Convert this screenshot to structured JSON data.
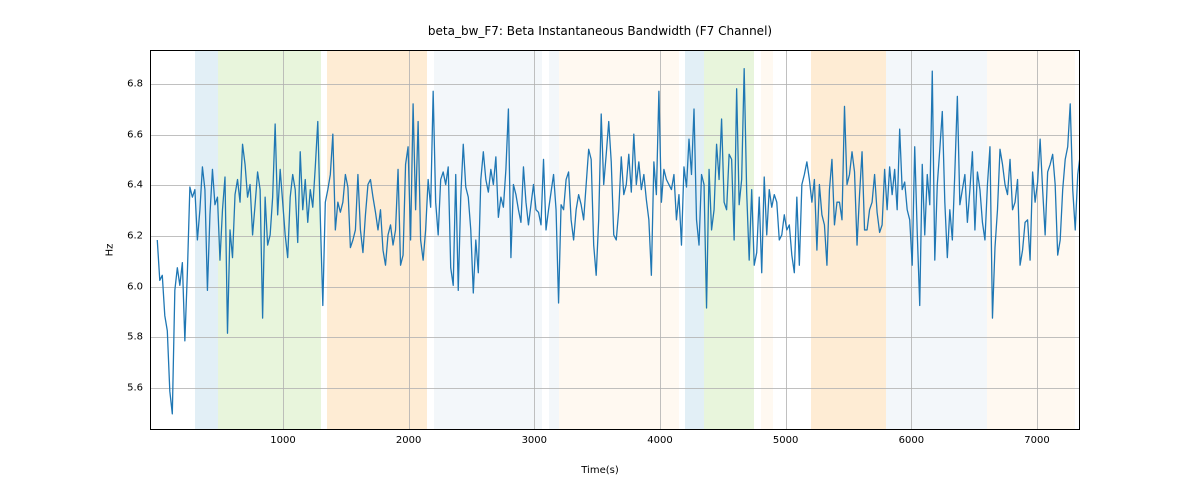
{
  "chart_data": {
    "type": "line",
    "title": "beta_bw_F7: Beta Instantaneous Bandwidth (F7 Channel)",
    "xlabel": "Time(s)",
    "ylabel": "Hz",
    "xlim": [
      -50,
      7350
    ],
    "ylim": [
      5.43,
      6.93
    ],
    "xticks": [
      "1000",
      "2000",
      "3000",
      "4000",
      "5000",
      "6000",
      "7000"
    ],
    "yticks": [
      "5.6",
      "5.8",
      "6.0",
      "6.2",
      "6.4",
      "6.6",
      "6.8"
    ],
    "spans": [
      {
        "x0": 300,
        "x1": 480,
        "color": "#9ec9e2"
      },
      {
        "x0": 480,
        "x1": 1300,
        "color": "#b2df8a"
      },
      {
        "x0": 1350,
        "x1": 2150,
        "color": "#fdbf6f"
      },
      {
        "x0": 2200,
        "x1": 3060,
        "color": "#d6e4f0"
      },
      {
        "x0": 3120,
        "x1": 3200,
        "color": "#d6e4f0"
      },
      {
        "x0": 3200,
        "x1": 4150,
        "color": "#ffecd1"
      },
      {
        "x0": 4200,
        "x1": 4350,
        "color": "#9ec9e2"
      },
      {
        "x0": 4350,
        "x1": 4750,
        "color": "#b2df8a"
      },
      {
        "x0": 4800,
        "x1": 4900,
        "color": "#ffecd1"
      },
      {
        "x0": 5200,
        "x1": 5800,
        "color": "#fdbf6f"
      },
      {
        "x0": 5800,
        "x1": 6600,
        "color": "#d6e4f0"
      },
      {
        "x0": 6600,
        "x1": 7300,
        "color": "#ffecd1"
      }
    ],
    "series": [
      {
        "name": "beta_bw_F7",
        "x_start": 0,
        "x_step": 20,
        "y": [
          6.18,
          6.02,
          6.04,
          5.88,
          5.82,
          5.58,
          5.49,
          5.98,
          6.07,
          6.0,
          6.09,
          5.78,
          6.05,
          6.39,
          6.35,
          6.38,
          6.18,
          6.3,
          6.47,
          6.38,
          5.98,
          6.28,
          6.46,
          6.32,
          6.35,
          6.1,
          6.3,
          6.43,
          5.81,
          6.22,
          6.11,
          6.36,
          6.42,
          6.33,
          6.56,
          6.48,
          6.35,
          6.4,
          6.2,
          6.32,
          6.45,
          6.38,
          5.87,
          6.35,
          6.16,
          6.2,
          6.35,
          6.64,
          6.28,
          6.46,
          6.33,
          6.2,
          6.11,
          6.35,
          6.44,
          6.38,
          6.17,
          6.53,
          6.3,
          6.42,
          6.25,
          6.38,
          6.31,
          6.47,
          6.65,
          6.27,
          5.92,
          6.33,
          6.38,
          6.44,
          6.6,
          6.22,
          6.33,
          6.29,
          6.33,
          6.44,
          6.39,
          6.15,
          6.18,
          6.22,
          6.44,
          6.22,
          6.13,
          6.28,
          6.4,
          6.42,
          6.35,
          6.29,
          6.22,
          6.3,
          6.14,
          6.08,
          6.2,
          6.24,
          6.16,
          6.22,
          6.46,
          6.08,
          6.12,
          6.48,
          6.55,
          6.18,
          6.72,
          6.3,
          6.65,
          6.18,
          6.1,
          6.22,
          6.42,
          6.31,
          6.77,
          6.33,
          6.2,
          6.42,
          6.45,
          6.4,
          6.47,
          6.07,
          6.0,
          6.44,
          5.98,
          6.35,
          6.56,
          6.39,
          6.35,
          6.22,
          5.97,
          6.18,
          6.05,
          6.42,
          6.53,
          6.42,
          6.37,
          6.46,
          6.4,
          6.51,
          6.27,
          6.35,
          6.31,
          6.46,
          6.7,
          6.11,
          6.4,
          6.36,
          6.3,
          6.25,
          6.47,
          6.33,
          6.24,
          6.32,
          6.4,
          6.3,
          6.29,
          6.24,
          6.5,
          6.22,
          6.3,
          6.37,
          6.44,
          6.3,
          5.93,
          6.32,
          6.3,
          6.42,
          6.45,
          6.26,
          6.18,
          6.3,
          6.36,
          6.32,
          6.26,
          6.4,
          6.54,
          6.5,
          6.16,
          6.04,
          6.26,
          6.68,
          6.4,
          6.52,
          6.65,
          6.49,
          6.2,
          6.18,
          6.3,
          6.51,
          6.36,
          6.4,
          6.52,
          6.37,
          6.6,
          6.4,
          6.49,
          6.38,
          6.44,
          6.34,
          6.26,
          6.04,
          6.49,
          6.36,
          6.77,
          6.33,
          6.46,
          6.42,
          6.4,
          6.38,
          6.44,
          6.26,
          6.36,
          6.16,
          6.47,
          6.39,
          6.58,
          6.44,
          6.7,
          6.26,
          6.16,
          6.44,
          6.4,
          5.91,
          6.46,
          6.22,
          6.3,
          6.56,
          6.42,
          6.66,
          6.33,
          6.3,
          6.52,
          6.5,
          6.18,
          6.78,
          6.32,
          6.42,
          6.86,
          6.37,
          6.1,
          6.38,
          6.08,
          6.13,
          6.35,
          6.05,
          6.43,
          6.2,
          6.38,
          6.31,
          6.36,
          6.33,
          6.18,
          6.2,
          6.28,
          6.22,
          6.24,
          6.12,
          6.05,
          6.35,
          6.08,
          6.4,
          6.44,
          6.49,
          6.42,
          6.33,
          6.42,
          6.14,
          6.4,
          6.28,
          6.24,
          6.08,
          6.38,
          6.5,
          6.24,
          6.33,
          6.33,
          6.26,
          6.71,
          6.4,
          6.44,
          6.53,
          6.45,
          6.16,
          6.36,
          6.53,
          6.22,
          6.22,
          6.3,
          6.33,
          6.44,
          6.29,
          6.21,
          6.24,
          6.46,
          6.3,
          6.47,
          6.36,
          6.46,
          6.3,
          6.62,
          6.38,
          6.41,
          6.3,
          6.26,
          6.08,
          6.55,
          6.21,
          5.92,
          6.48,
          6.2,
          6.44,
          6.32,
          6.85,
          6.1,
          6.4,
          6.54,
          6.69,
          6.33,
          6.11,
          6.3,
          6.18,
          6.45,
          6.75,
          6.32,
          6.38,
          6.44,
          6.25,
          6.38,
          6.53,
          6.22,
          6.45,
          6.38,
          6.25,
          6.18,
          6.4,
          6.55,
          5.87,
          6.15,
          6.3,
          6.54,
          6.48,
          6.4,
          6.36,
          6.5,
          6.3,
          6.33,
          6.42,
          6.08,
          6.14,
          6.25,
          6.26,
          6.1,
          6.45,
          6.33,
          6.41,
          6.58,
          6.38,
          6.2,
          6.45,
          6.48,
          6.52,
          6.4,
          6.12,
          6.18,
          6.38,
          6.5,
          6.55,
          6.72,
          6.38,
          6.22,
          6.44,
          6.52,
          6.65
        ]
      }
    ]
  }
}
